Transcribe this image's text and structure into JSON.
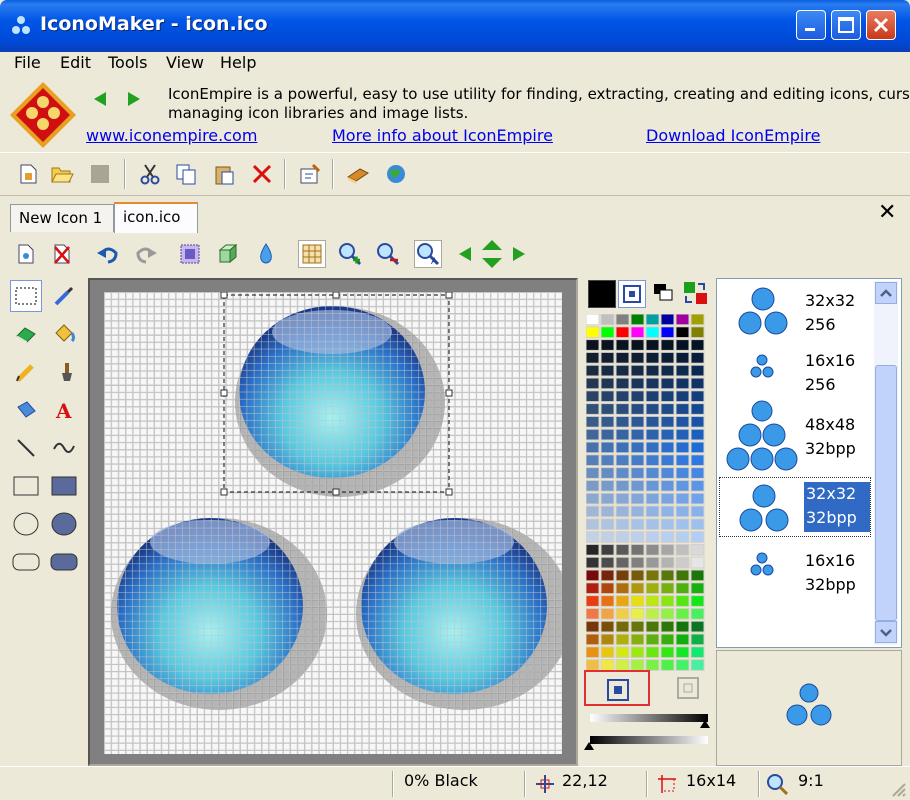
{
  "window": {
    "app_name": "IconoMaker",
    "title": "IconoMaker - icon.ico"
  },
  "menu": [
    "File",
    "Edit",
    "Tools",
    "View",
    "Help"
  ],
  "banner": {
    "text_line1": "IconEmpire is a powerful, easy to use utility for finding, extracting, creating and editing icons, curso",
    "text_line2": "managing icon libraries and image lists.",
    "links": [
      "www.iconempire.com",
      "More info about IconEmpire",
      "Download IconEmpire"
    ]
  },
  "tabs": [
    {
      "label": "New Icon 1"
    },
    {
      "label": "icon.ico",
      "active": true
    }
  ],
  "tab_close": "✕",
  "icon_formats": [
    {
      "size": "32x32",
      "depth": "256"
    },
    {
      "size": "16x16",
      "depth": "256"
    },
    {
      "size": "48x48",
      "depth": "32bpp"
    },
    {
      "size": "32x32",
      "depth": "32bpp",
      "selected": true
    },
    {
      "size": "16x16",
      "depth": "32bpp"
    }
  ],
  "status": {
    "color": "0% Black",
    "cursor": "22,12",
    "selection": "16x14",
    "zoom": "9:1"
  },
  "colors": {
    "accent": "#316ac5",
    "titlebar": "#0055e5",
    "selection_border": "#ff0000"
  }
}
